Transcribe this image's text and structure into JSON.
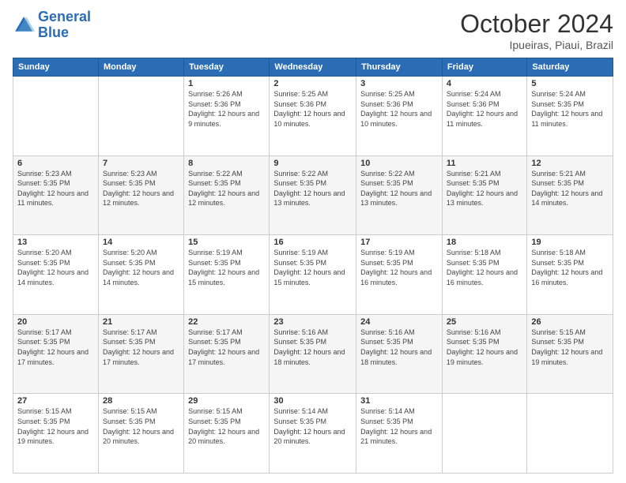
{
  "header": {
    "logo_line1": "General",
    "logo_line2": "Blue",
    "main_title": "October 2024",
    "subtitle": "Ipueiras, Piaui, Brazil"
  },
  "calendar": {
    "weekdays": [
      "Sunday",
      "Monday",
      "Tuesday",
      "Wednesday",
      "Thursday",
      "Friday",
      "Saturday"
    ],
    "weeks": [
      [
        {
          "day": "",
          "sunrise": "",
          "sunset": "",
          "daylight": ""
        },
        {
          "day": "",
          "sunrise": "",
          "sunset": "",
          "daylight": ""
        },
        {
          "day": "1",
          "sunrise": "Sunrise: 5:26 AM",
          "sunset": "Sunset: 5:36 PM",
          "daylight": "Daylight: 12 hours and 9 minutes."
        },
        {
          "day": "2",
          "sunrise": "Sunrise: 5:25 AM",
          "sunset": "Sunset: 5:36 PM",
          "daylight": "Daylight: 12 hours and 10 minutes."
        },
        {
          "day": "3",
          "sunrise": "Sunrise: 5:25 AM",
          "sunset": "Sunset: 5:36 PM",
          "daylight": "Daylight: 12 hours and 10 minutes."
        },
        {
          "day": "4",
          "sunrise": "Sunrise: 5:24 AM",
          "sunset": "Sunset: 5:36 PM",
          "daylight": "Daylight: 12 hours and 11 minutes."
        },
        {
          "day": "5",
          "sunrise": "Sunrise: 5:24 AM",
          "sunset": "Sunset: 5:35 PM",
          "daylight": "Daylight: 12 hours and 11 minutes."
        }
      ],
      [
        {
          "day": "6",
          "sunrise": "Sunrise: 5:23 AM",
          "sunset": "Sunset: 5:35 PM",
          "daylight": "Daylight: 12 hours and 11 minutes."
        },
        {
          "day": "7",
          "sunrise": "Sunrise: 5:23 AM",
          "sunset": "Sunset: 5:35 PM",
          "daylight": "Daylight: 12 hours and 12 minutes."
        },
        {
          "day": "8",
          "sunrise": "Sunrise: 5:22 AM",
          "sunset": "Sunset: 5:35 PM",
          "daylight": "Daylight: 12 hours and 12 minutes."
        },
        {
          "day": "9",
          "sunrise": "Sunrise: 5:22 AM",
          "sunset": "Sunset: 5:35 PM",
          "daylight": "Daylight: 12 hours and 13 minutes."
        },
        {
          "day": "10",
          "sunrise": "Sunrise: 5:22 AM",
          "sunset": "Sunset: 5:35 PM",
          "daylight": "Daylight: 12 hours and 13 minutes."
        },
        {
          "day": "11",
          "sunrise": "Sunrise: 5:21 AM",
          "sunset": "Sunset: 5:35 PM",
          "daylight": "Daylight: 12 hours and 13 minutes."
        },
        {
          "day": "12",
          "sunrise": "Sunrise: 5:21 AM",
          "sunset": "Sunset: 5:35 PM",
          "daylight": "Daylight: 12 hours and 14 minutes."
        }
      ],
      [
        {
          "day": "13",
          "sunrise": "Sunrise: 5:20 AM",
          "sunset": "Sunset: 5:35 PM",
          "daylight": "Daylight: 12 hours and 14 minutes."
        },
        {
          "day": "14",
          "sunrise": "Sunrise: 5:20 AM",
          "sunset": "Sunset: 5:35 PM",
          "daylight": "Daylight: 12 hours and 14 minutes."
        },
        {
          "day": "15",
          "sunrise": "Sunrise: 5:19 AM",
          "sunset": "Sunset: 5:35 PM",
          "daylight": "Daylight: 12 hours and 15 minutes."
        },
        {
          "day": "16",
          "sunrise": "Sunrise: 5:19 AM",
          "sunset": "Sunset: 5:35 PM",
          "daylight": "Daylight: 12 hours and 15 minutes."
        },
        {
          "day": "17",
          "sunrise": "Sunrise: 5:19 AM",
          "sunset": "Sunset: 5:35 PM",
          "daylight": "Daylight: 12 hours and 16 minutes."
        },
        {
          "day": "18",
          "sunrise": "Sunrise: 5:18 AM",
          "sunset": "Sunset: 5:35 PM",
          "daylight": "Daylight: 12 hours and 16 minutes."
        },
        {
          "day": "19",
          "sunrise": "Sunrise: 5:18 AM",
          "sunset": "Sunset: 5:35 PM",
          "daylight": "Daylight: 12 hours and 16 minutes."
        }
      ],
      [
        {
          "day": "20",
          "sunrise": "Sunrise: 5:17 AM",
          "sunset": "Sunset: 5:35 PM",
          "daylight": "Daylight: 12 hours and 17 minutes."
        },
        {
          "day": "21",
          "sunrise": "Sunrise: 5:17 AM",
          "sunset": "Sunset: 5:35 PM",
          "daylight": "Daylight: 12 hours and 17 minutes."
        },
        {
          "day": "22",
          "sunrise": "Sunrise: 5:17 AM",
          "sunset": "Sunset: 5:35 PM",
          "daylight": "Daylight: 12 hours and 17 minutes."
        },
        {
          "day": "23",
          "sunrise": "Sunrise: 5:16 AM",
          "sunset": "Sunset: 5:35 PM",
          "daylight": "Daylight: 12 hours and 18 minutes."
        },
        {
          "day": "24",
          "sunrise": "Sunrise: 5:16 AM",
          "sunset": "Sunset: 5:35 PM",
          "daylight": "Daylight: 12 hours and 18 minutes."
        },
        {
          "day": "25",
          "sunrise": "Sunrise: 5:16 AM",
          "sunset": "Sunset: 5:35 PM",
          "daylight": "Daylight: 12 hours and 19 minutes."
        },
        {
          "day": "26",
          "sunrise": "Sunrise: 5:15 AM",
          "sunset": "Sunset: 5:35 PM",
          "daylight": "Daylight: 12 hours and 19 minutes."
        }
      ],
      [
        {
          "day": "27",
          "sunrise": "Sunrise: 5:15 AM",
          "sunset": "Sunset: 5:35 PM",
          "daylight": "Daylight: 12 hours and 19 minutes."
        },
        {
          "day": "28",
          "sunrise": "Sunrise: 5:15 AM",
          "sunset": "Sunset: 5:35 PM",
          "daylight": "Daylight: 12 hours and 20 minutes."
        },
        {
          "day": "29",
          "sunrise": "Sunrise: 5:15 AM",
          "sunset": "Sunset: 5:35 PM",
          "daylight": "Daylight: 12 hours and 20 minutes."
        },
        {
          "day": "30",
          "sunrise": "Sunrise: 5:14 AM",
          "sunset": "Sunset: 5:35 PM",
          "daylight": "Daylight: 12 hours and 20 minutes."
        },
        {
          "day": "31",
          "sunrise": "Sunrise: 5:14 AM",
          "sunset": "Sunset: 5:35 PM",
          "daylight": "Daylight: 12 hours and 21 minutes."
        },
        {
          "day": "",
          "sunrise": "",
          "sunset": "",
          "daylight": ""
        },
        {
          "day": "",
          "sunrise": "",
          "sunset": "",
          "daylight": ""
        }
      ]
    ]
  }
}
